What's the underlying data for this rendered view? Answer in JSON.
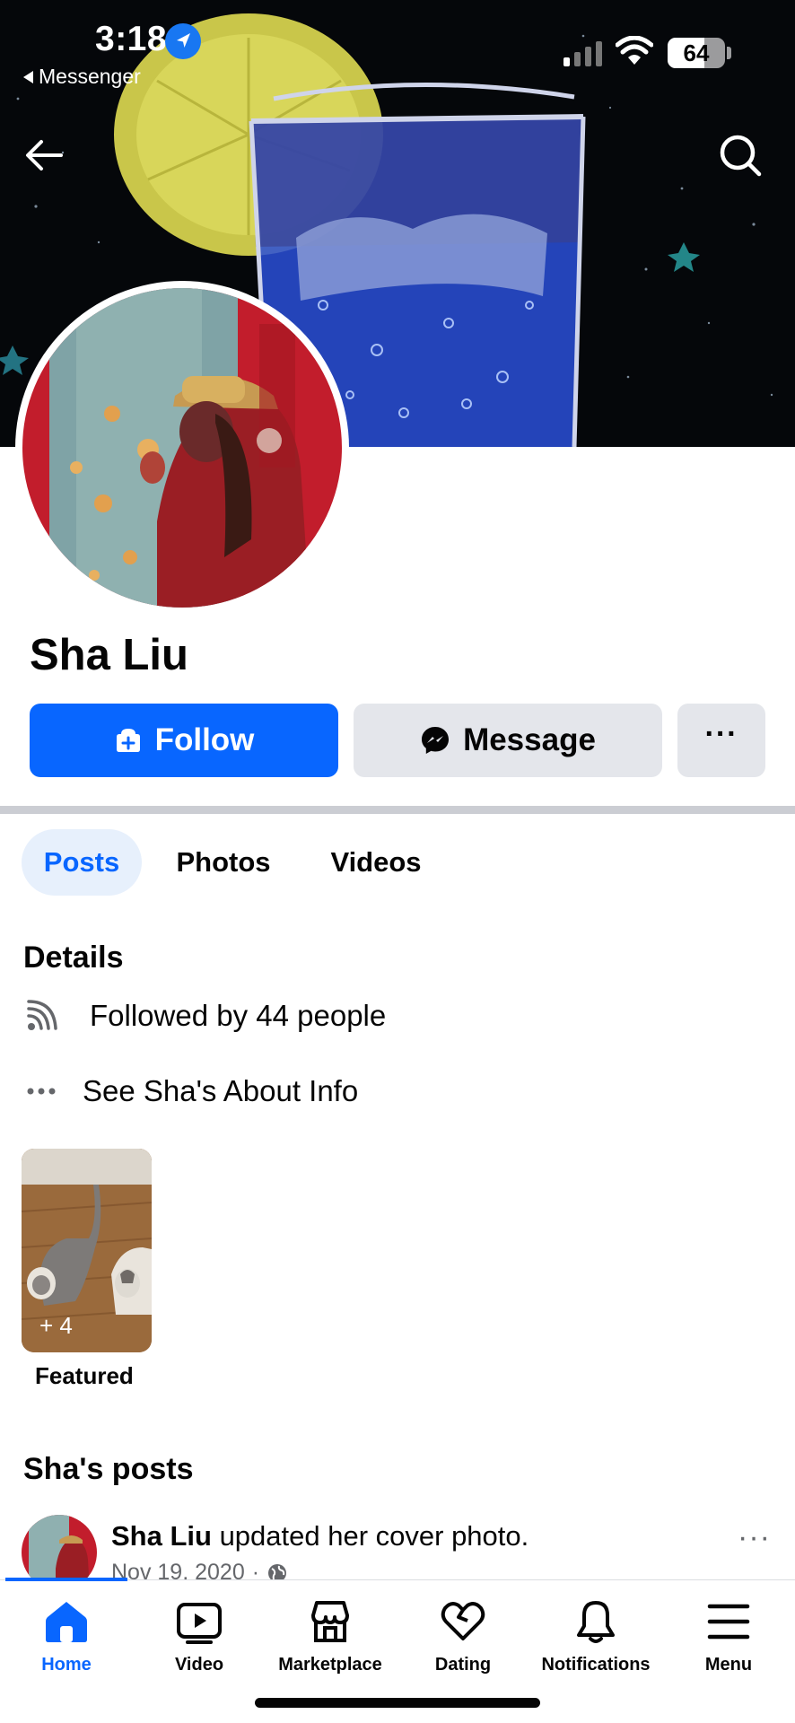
{
  "status_bar": {
    "time": "3:18",
    "back_app": "Messenger",
    "battery": "64",
    "battery_level": 0.64
  },
  "profile": {
    "name": "Sha Liu"
  },
  "actions": {
    "follow_label": "Follow",
    "message_label": "Message",
    "more_label": "···"
  },
  "tabs": [
    {
      "label": "Posts",
      "active": true
    },
    {
      "label": "Photos",
      "active": false
    },
    {
      "label": "Videos",
      "active": false
    }
  ],
  "details": {
    "title": "Details",
    "followers": "Followed by 44 people",
    "about": "See Sha's About Info"
  },
  "featured": {
    "count": "+ 4",
    "label": "Featured"
  },
  "posts_section": {
    "title": "Sha's posts",
    "author": "Sha Liu",
    "action": " updated her cover photo.",
    "date": "Nov 19, 2020",
    "separator": "·"
  },
  "bottom_nav": [
    {
      "label": "Home",
      "icon": "home-icon",
      "active": true
    },
    {
      "label": "Video",
      "icon": "video-icon",
      "active": false
    },
    {
      "label": "Marketplace",
      "icon": "marketplace-icon",
      "active": false
    },
    {
      "label": "Dating",
      "icon": "dating-icon",
      "active": false
    },
    {
      "label": "Notifications",
      "icon": "bell-icon",
      "active": false
    },
    {
      "label": "Menu",
      "icon": "menu-icon",
      "active": false
    }
  ],
  "colors": {
    "brand_blue": "#0866ff",
    "button_gray": "#e4e6eb",
    "tab_active_bg": "#e7f0fc",
    "secondary_text": "#65676b"
  }
}
